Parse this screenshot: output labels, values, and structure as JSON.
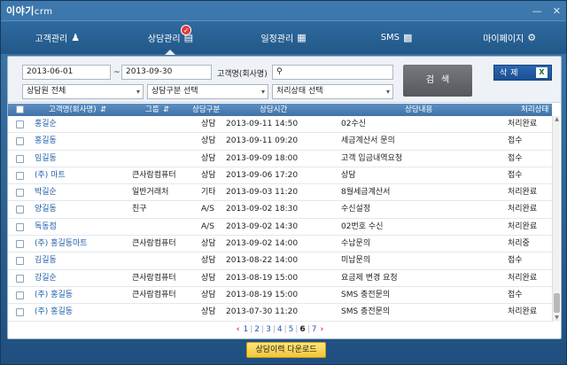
{
  "app": {
    "logo": "이야기",
    "logo_suffix": "crm"
  },
  "window": {
    "minimize": "—",
    "close": "✕"
  },
  "nav": [
    {
      "label": "고객관리",
      "icon": "person-icon"
    },
    {
      "label": "상담관리",
      "icon": "notepad-icon",
      "active": true
    },
    {
      "label": "일정관리",
      "icon": "calendar-icon"
    },
    {
      "label": "SMS",
      "icon": "sms-icon"
    },
    {
      "label": "마이페이지",
      "icon": "gear-icon"
    }
  ],
  "filter": {
    "date_from": "2013-06-01",
    "date_sep": "~",
    "date_to": "2013-09-30",
    "customer_label": "고객명(회사명)",
    "search_placeholder": "",
    "counselor": "상담원 전체",
    "category": "상담구분 선택",
    "status": "처리상태 선택",
    "search_button": "검색",
    "delete_button": "삭제",
    "excel_icon": "X"
  },
  "table": {
    "headers": [
      "고객명(회사명)",
      "그룹",
      "상담구분",
      "상담시간",
      "상담내용",
      "처리상태"
    ],
    "rows": [
      {
        "name": "홍길순",
        "group": "",
        "type": "상담",
        "time": "2013-09-11 14:50",
        "content": "02수신",
        "status": "처리완료"
      },
      {
        "name": "홍길동",
        "group": "",
        "type": "상담",
        "time": "2013-09-11 09:20",
        "content": "세금계산서 문의",
        "status": "접수"
      },
      {
        "name": "임길동",
        "group": "",
        "type": "상담",
        "time": "2013-09-09 18:00",
        "content": "고객 입금내역요청",
        "status": "접수"
      },
      {
        "name": "(주) 마트",
        "group": "큰사람컴퓨터",
        "type": "상담",
        "time": "2013-09-06 17:20",
        "content": "상담",
        "status": "접수"
      },
      {
        "name": "박길순",
        "group": "일반거래처",
        "type": "기타",
        "time": "2013-09-03 11:20",
        "content": "8월세금계산서",
        "status": "처리완료"
      },
      {
        "name": "양길동",
        "group": "친구",
        "type": "A/S",
        "time": "2013-09-02 18:30",
        "content": "수신설정",
        "status": "처리완료"
      },
      {
        "name": "독동점",
        "group": "",
        "type": "A/S",
        "time": "2013-09-02 14:30",
        "content": "02번호 수신",
        "status": "처리완료"
      },
      {
        "name": "(주) 홍길동마트",
        "group": "큰사람컴퓨터",
        "type": "상담",
        "time": "2013-09-02 14:00",
        "content": "수납문의",
        "status": "처리중"
      },
      {
        "name": "김길동",
        "group": "",
        "type": "상담",
        "time": "2013-08-22 14:00",
        "content": "미납문의",
        "status": "접수"
      },
      {
        "name": "강길순",
        "group": "큰사람컴퓨터",
        "type": "상담",
        "time": "2013-08-19 15:00",
        "content": "요금제 변경 요청",
        "status": "처리완료"
      },
      {
        "name": "(주) 홍길동",
        "group": "큰사람컴퓨터",
        "type": "상담",
        "time": "2013-08-19 15:00",
        "content": "SMS 충전문의",
        "status": "접수"
      },
      {
        "name": "(주) 홍길동",
        "group": "",
        "type": "상담",
        "time": "2013-07-30 11:20",
        "content": "SMS 충전문의",
        "status": "처리완료"
      }
    ]
  },
  "pager": {
    "prev": "‹",
    "pages": [
      "1",
      "2",
      "3",
      "4",
      "5",
      "6",
      "7"
    ],
    "current": "6",
    "next": "›"
  },
  "download_button": "상담이력 다운로드",
  "colors": {
    "accent": "#2a67b1",
    "nav_bg": "#225887",
    "name_link": "#1e5ea8",
    "download": "#f2c53a"
  }
}
